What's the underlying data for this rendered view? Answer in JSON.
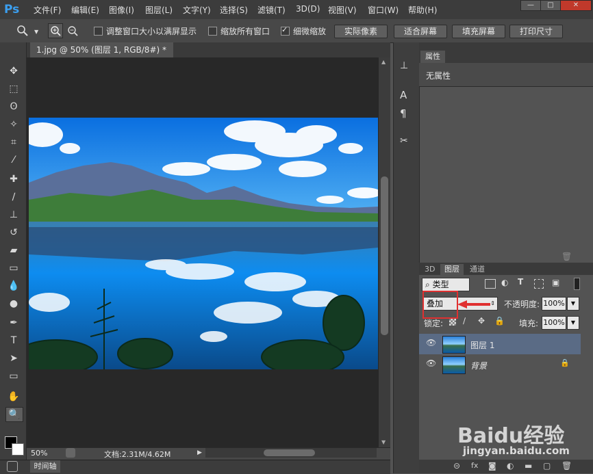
{
  "app": {
    "logo": "Ps"
  },
  "menu": [
    "文件(F)",
    "编辑(E)",
    "图像(I)",
    "图层(L)",
    "文字(Y)",
    "选择(S)",
    "滤镜(T)",
    "3D(D)",
    "视图(V)",
    "窗口(W)",
    "帮助(H)"
  ],
  "window_controls": {
    "minimize": "—",
    "maximize": "□",
    "close": "✕"
  },
  "options": {
    "resize_windows": {
      "label": "调整窗口大小以满屏显示",
      "checked": false
    },
    "zoom_all": {
      "label": "缩放所有窗口",
      "checked": false
    },
    "scrubby_zoom": {
      "label": "细微缩放",
      "checked": true
    },
    "buttons": [
      "实际像素",
      "适合屏幕",
      "填充屏幕",
      "打印尺寸"
    ]
  },
  "document": {
    "tab_title": "1.jpg @ 50% (图层 1, RGB/8#) *",
    "close_symbol": "×",
    "zoom": "50%",
    "doc_info": "文档:2.31M/4.62M"
  },
  "timeline": {
    "label": "时间轴"
  },
  "properties": {
    "tab": "属性",
    "content": "无属性"
  },
  "layers_panel": {
    "tabs": [
      "3D",
      "图层",
      "通道"
    ],
    "filter_kind": "类型",
    "blend_mode": "叠加",
    "opacity_label": "不透明度:",
    "opacity_value": "100%",
    "lock_label": "锁定:",
    "fill_label": "填充:",
    "fill_value": "100%",
    "layers": [
      {
        "name": "图层 1",
        "selected": true,
        "locked": false
      },
      {
        "name": "背景",
        "selected": false,
        "locked": true
      }
    ]
  },
  "watermark": {
    "brand": "Baidu经验",
    "url": "jingyan.baidu.com"
  },
  "colors": {
    "menubar": "#3c3c3c",
    "panel": "#535353",
    "canvas_bg": "#282828",
    "highlight": "#e03030",
    "selected_layer": "#5a6b85"
  }
}
